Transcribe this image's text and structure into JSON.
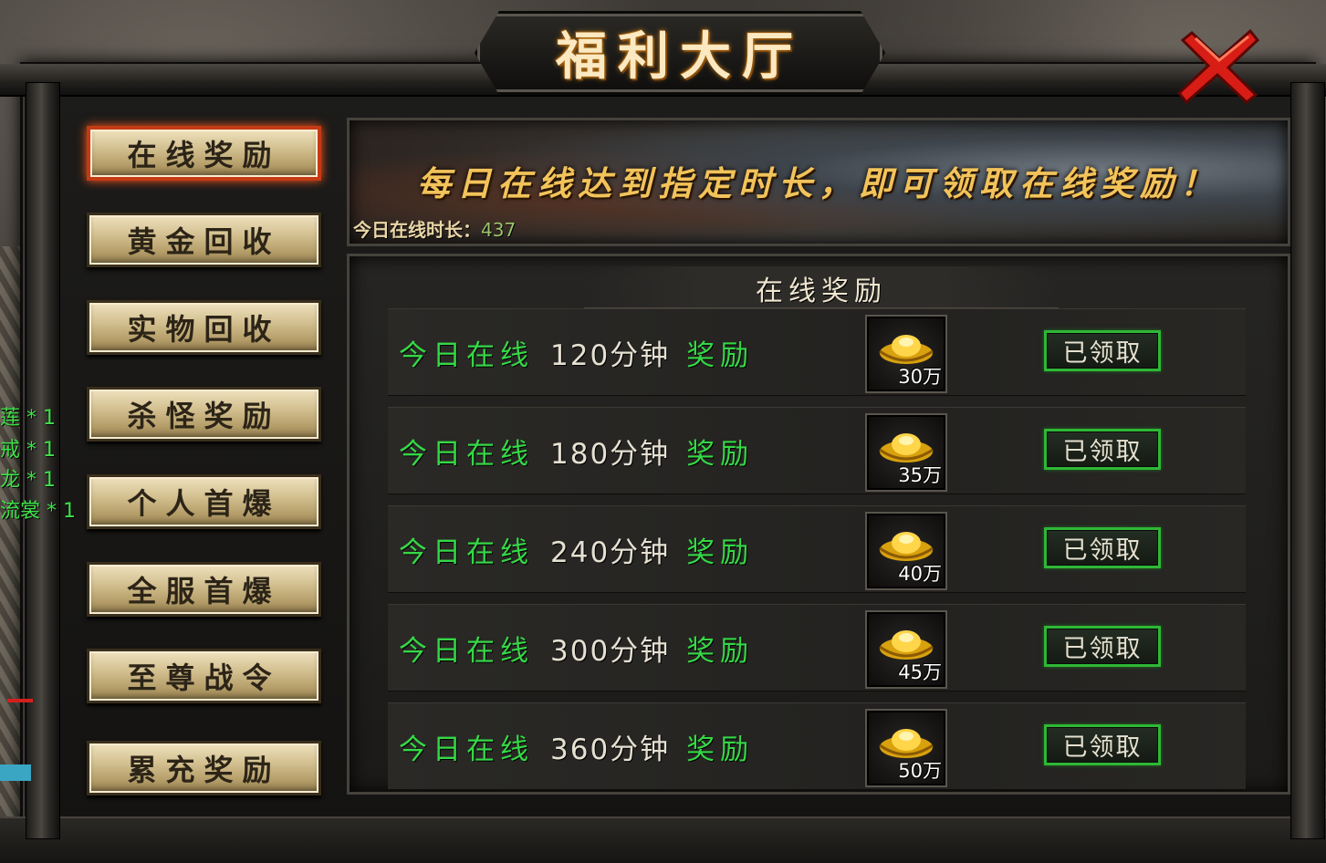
{
  "window": {
    "title": "福利大厅",
    "close_icon": "close-x-icon"
  },
  "nav": {
    "items": [
      {
        "label": "在线奖励",
        "active": true
      },
      {
        "label": "黄金回收",
        "active": false
      },
      {
        "label": "实物回收",
        "active": false
      },
      {
        "label": "杀怪奖励",
        "active": false
      },
      {
        "label": "个人首爆",
        "active": false
      },
      {
        "label": "全服首爆",
        "active": false
      },
      {
        "label": "至尊战令",
        "active": false
      },
      {
        "label": "累充奖励",
        "active": false
      }
    ]
  },
  "chat": {
    "lines": [
      "莲 * 1",
      "戒 * 1",
      "龙 * 1",
      "流裳 * 1"
    ]
  },
  "banner": {
    "slogan": "每日在线达到指定时长，即可领取在线奖励！",
    "online_time_label": "今日在线时长：",
    "online_time_value": "437"
  },
  "panel": {
    "title": "在线奖励",
    "rows": [
      {
        "prefix": "今日在线",
        "minutes": "120分钟",
        "suffix": "奖励",
        "amount": "30万",
        "status": "已领取"
      },
      {
        "prefix": "今日在线",
        "minutes": "180分钟",
        "suffix": "奖励",
        "amount": "35万",
        "status": "已领取"
      },
      {
        "prefix": "今日在线",
        "minutes": "240分钟",
        "suffix": "奖励",
        "amount": "40万",
        "status": "已领取"
      },
      {
        "prefix": "今日在线",
        "minutes": "300分钟",
        "suffix": "奖励",
        "amount": "45万",
        "status": "已领取"
      },
      {
        "prefix": "今日在线",
        "minutes": "360分钟",
        "suffix": "奖励",
        "amount": "50万",
        "status": "已领取"
      }
    ]
  },
  "colors": {
    "accent_gold": "#f2c35a",
    "reward_green": "#35d846",
    "claimed_border": "#2fb736",
    "active_nav_border": "#c43a14"
  }
}
